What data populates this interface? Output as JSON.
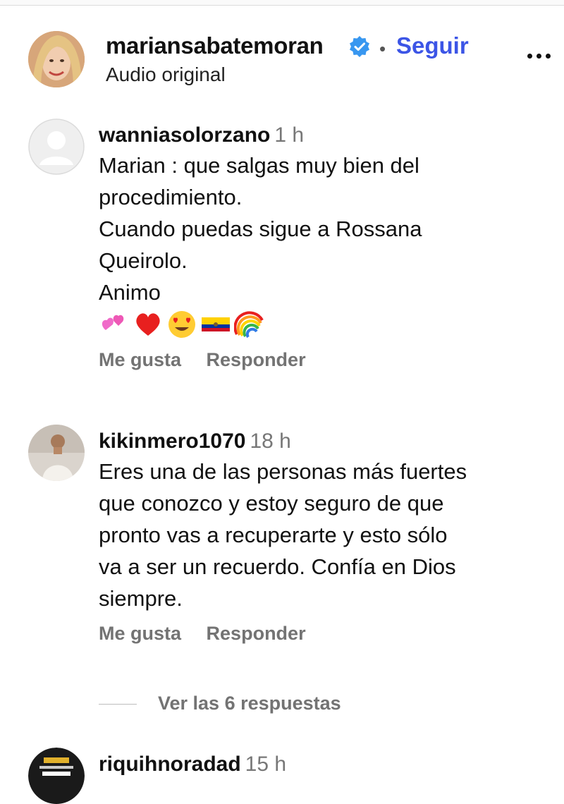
{
  "post": {
    "username": "mariansabatemoran",
    "verified": true,
    "follow_label": "Seguir",
    "separator": "•",
    "subtitle": "Audio original",
    "more_icon": "more-horizontal-icon"
  },
  "comments": [
    {
      "username": "wanniasolorzano",
      "time": "1 h",
      "lines": [
        "Marian : que salgas muy bien del",
        "procedimiento.",
        "Cuando puedas sigue a Rossana",
        "Queirolo.",
        "Animo"
      ],
      "emojis": [
        "two-hearts",
        "red-heart",
        "heart-eyes",
        "flag-ecuador",
        "rainbow"
      ],
      "like_label": "Me gusta",
      "reply_label": "Responder"
    },
    {
      "username": "kikinmero1070",
      "time": "18 h",
      "lines": [
        "Eres una de las personas más fuertes",
        "que conozco y estoy seguro de que",
        "pronto vas a recuperarte y esto sólo",
        "va a ser un recuerdo. Confía en Dios",
        "siempre."
      ],
      "like_label": "Me gusta",
      "reply_label": "Responder",
      "view_replies_label": "Ver las 6 respuestas"
    },
    {
      "username": "riquihnoradad",
      "time": "15 h"
    }
  ],
  "colors": {
    "link_blue": "#3c55e6",
    "verified_blue": "#3897f0",
    "muted": "#737373"
  }
}
